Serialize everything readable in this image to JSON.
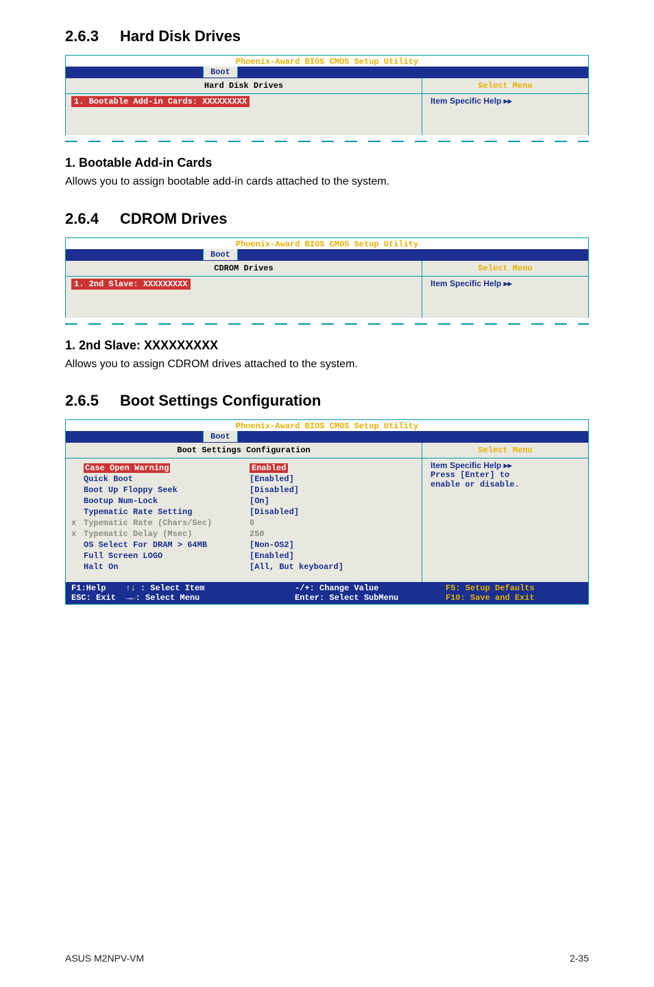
{
  "sections": {
    "s263": {
      "num": "2.6.3",
      "title": "Hard Disk Drives"
    },
    "s264": {
      "num": "2.6.4",
      "title": "CDROM Drives"
    },
    "s265": {
      "num": "2.6.5",
      "title": "Boot Settings Configuration"
    }
  },
  "bios_common": {
    "util_title": "Phoenix-Award BIOS CMOS Setup Utility",
    "tab_label": "Boot",
    "select_menu": "Select Menu",
    "help_label": "Item Specific Help ▸▸"
  },
  "hdd_panel": {
    "heading": "Hard Disk Drives",
    "item1": "1. Bootable Add-in Cards: XXXXXXXXX"
  },
  "hdd_text": {
    "h": "1. Bootable Add-in Cards",
    "p": "Allows you to assign bootable add-in cards attached to the system."
  },
  "cdrom_panel": {
    "heading": "CDROM Drives",
    "item1": "1. 2nd Slave: XXXXXXXXX"
  },
  "cdrom_text": {
    "h": "1. 2nd Slave: XXXXXXXXX",
    "p": "Allows you to assign CDROM drives attached to the system."
  },
  "bootcfg_panel": {
    "heading": "Boot Settings Configuration",
    "help_extra1": "Press [Enter] to",
    "help_extra2": "enable or disable.",
    "rows": [
      {
        "label": "Case Open Warning",
        "value": "Enabled",
        "highlighted": true,
        "dim_label": true
      },
      {
        "label": "Quick Boot",
        "value": "[Enabled]"
      },
      {
        "label": "Boot Up Floppy Seek",
        "value": "[Disabled]"
      },
      {
        "label": "Bootup Num-Lock",
        "value": "[On]"
      },
      {
        "label": "Typematic Rate Setting",
        "value": "[Disabled]"
      },
      {
        "label": "Typematic Rate (Chars/Sec)",
        "value": "6",
        "dim": true,
        "marker": "x"
      },
      {
        "label": "Typematic Delay (Msec)",
        "value": "250",
        "dim": true,
        "marker": "x"
      },
      {
        "label": "OS Select For DRAM > 64MB",
        "value": "[Non-OS2]"
      },
      {
        "label": "Full Screen LOGO",
        "value": "[Enabled]"
      },
      {
        "label": "Halt On",
        "value": "[All, But keyboard]"
      }
    ]
  },
  "footer_keys": {
    "f1": "F1:Help",
    "updown": "↑↓ : Select Item",
    "esc": "ESC: Exit",
    "lr": "→←: Select Menu",
    "chval": "-/+: Change Value",
    "enter": "Enter: Select SubMenu",
    "f5": "F5: Setup Defaults",
    "f10": "F10: Save and Exit"
  },
  "page_footer": {
    "left": "ASUS M2NPV-VM",
    "right": "2-35"
  }
}
